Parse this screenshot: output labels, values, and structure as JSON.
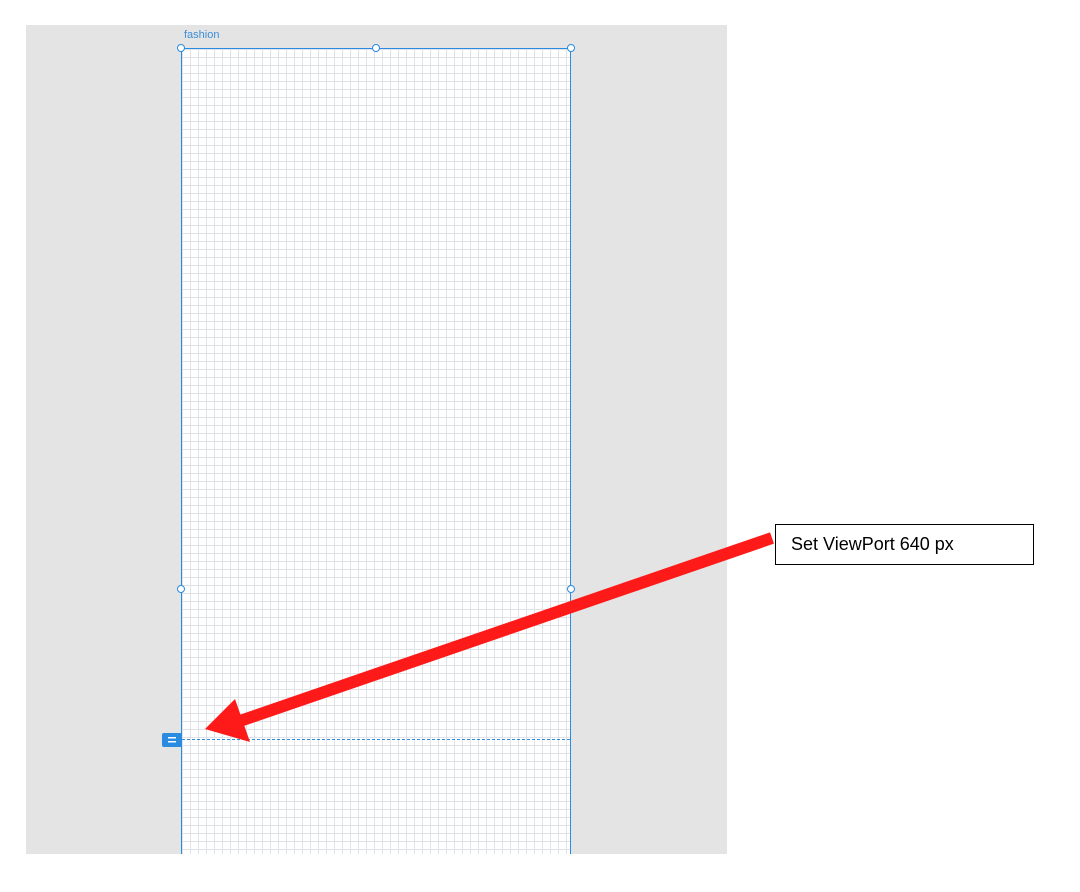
{
  "artboard": {
    "title": "fashion"
  },
  "viewport": {
    "marker_icon": "equals-icon"
  },
  "annotation": {
    "text": "Set ViewPort 640 px",
    "arrow_color": "#ff1a1a"
  },
  "colors": {
    "canvas": "#e4e4e4",
    "selection": "#2b8be0",
    "grid": "#dfe3e8"
  }
}
